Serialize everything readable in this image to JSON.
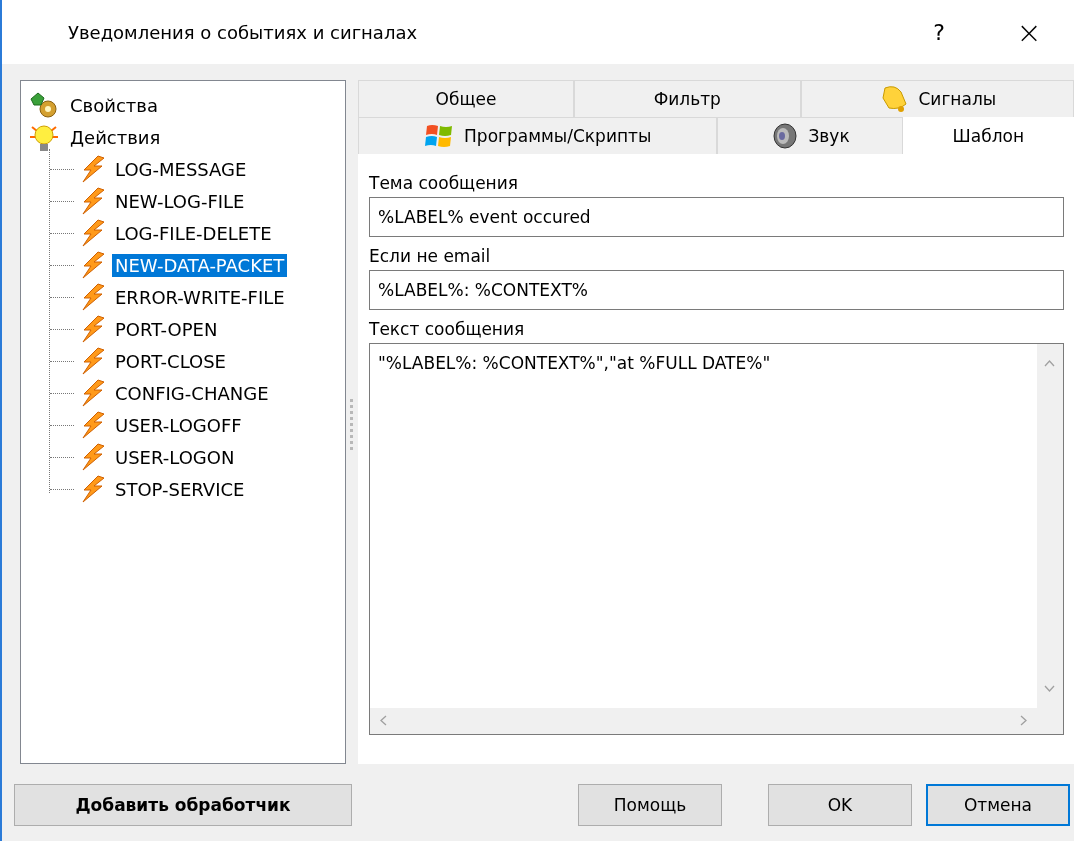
{
  "window": {
    "title": "Уведомления о событиях и сигналах",
    "help": "?",
    "close": "×"
  },
  "tree": {
    "items": [
      {
        "label": "Свойства",
        "kind": "properties",
        "selected": false
      },
      {
        "label": "Действия",
        "kind": "actions",
        "selected": false,
        "children": [
          {
            "label": "LOG-MESSAGE",
            "selected": false
          },
          {
            "label": "NEW-LOG-FILE",
            "selected": false
          },
          {
            "label": "LOG-FILE-DELETE",
            "selected": false
          },
          {
            "label": "NEW-DATA-PACKET",
            "selected": true
          },
          {
            "label": "ERROR-WRITE-FILE",
            "selected": false
          },
          {
            "label": "PORT-OPEN",
            "selected": false
          },
          {
            "label": "PORT-CLOSE",
            "selected": false
          },
          {
            "label": "CONFIG-CHANGE",
            "selected": false
          },
          {
            "label": "USER-LOGOFF",
            "selected": false
          },
          {
            "label": "USER-LOGON",
            "selected": false
          },
          {
            "label": "STOP-SERVICE",
            "selected": false
          }
        ]
      }
    ]
  },
  "tab_rows": [
    [
      {
        "label": "Общее",
        "kind": "plain",
        "selected": false
      },
      {
        "label": "Фильтр",
        "kind": "plain",
        "selected": false
      },
      {
        "label": "Сигналы",
        "kind": "bell",
        "selected": false
      }
    ],
    [
      {
        "label": "Программы/Скрипты",
        "kind": "programs",
        "selected": false
      },
      {
        "label": "Звук",
        "kind": "sound",
        "selected": false
      },
      {
        "label": "Шаблон",
        "kind": "plain",
        "selected": true
      }
    ]
  ],
  "form": {
    "fields": [
      {
        "label": "Тема сообщения",
        "value": "%LABEL% event occured",
        "kind": "line"
      },
      {
        "label": "Если не email",
        "value": "%LABEL%: %CONTEXT%",
        "kind": "line"
      },
      {
        "label": "Текст сообщения",
        "value": "\"%LABEL%: %CONTEXT%\",\"at %FULL DATE%\"",
        "kind": "multiline"
      }
    ]
  },
  "buttons": [
    {
      "label": "Добавить обработчик",
      "kind": "left",
      "default": false
    },
    {
      "label": "Помощь",
      "kind": "right",
      "default": false
    },
    {
      "label": "OK",
      "kind": "right",
      "default": false
    },
    {
      "label": "Отмена",
      "kind": "right",
      "default": true
    }
  ]
}
